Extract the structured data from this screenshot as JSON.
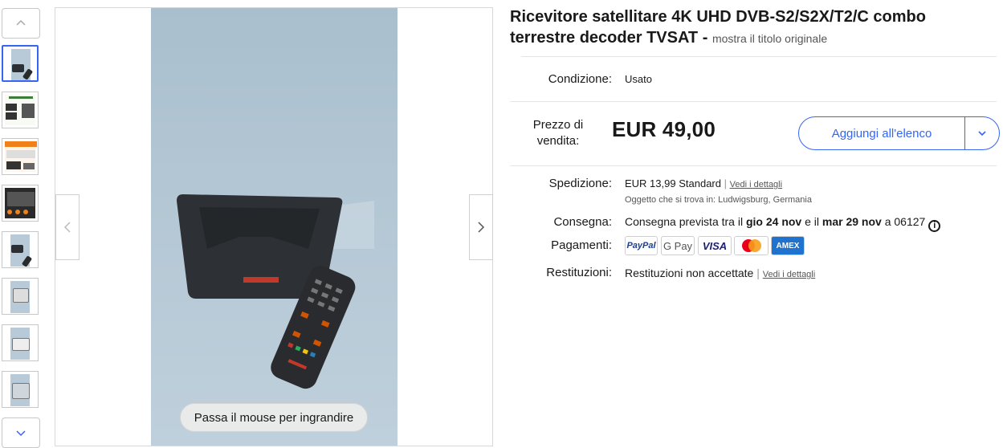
{
  "gallery": {
    "hover_hint": "Passa il mouse per ingrandire"
  },
  "listing": {
    "title": "Ricevitore satellitare 4K UHD DVB-S2/S2X/T2/C combo terrestre decoder TVSAT -",
    "original_title_link": "mostra il titolo originale",
    "condition_label": "Condizione:",
    "condition_value": "Usato",
    "price_label_1": "Prezzo di",
    "price_label_2": "vendita:",
    "price": "EUR 49,00",
    "add_to_list": "Aggiungi all'elenco",
    "shipping_label": "Spedizione:",
    "shipping_price": "EUR 13,99",
    "shipping_type": "Standard",
    "shipping_details": "Vedi i dettagli",
    "location": "Oggetto che si trova in: Ludwigsburg, Germania",
    "delivery_label": "Consegna:",
    "delivery_pre": "Consegna prevista tra il",
    "delivery_from": "gio 24 nov",
    "delivery_mid": "e il",
    "delivery_to": "mar 29 nov",
    "delivery_post": "a 06127",
    "payments_label": "Pagamenti:",
    "payments": [
      "PayPal",
      "G Pay",
      "VISA",
      "Mastercard",
      "AMEX"
    ],
    "returns_label": "Restituzioni:",
    "returns_value": "Restituzioni non accettate",
    "returns_details": "Vedi i dettagli"
  },
  "colors": {
    "accent": "#3665f3",
    "text": "#191919"
  }
}
